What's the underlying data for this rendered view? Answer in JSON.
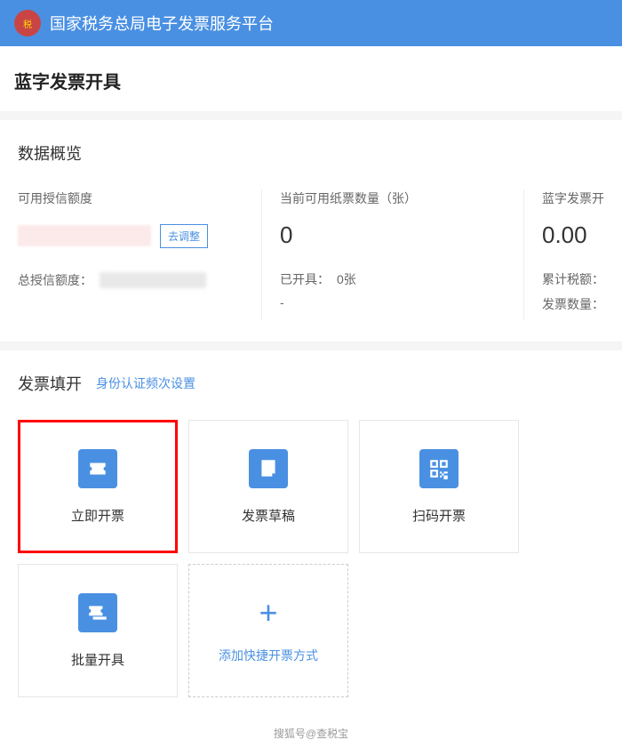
{
  "header": {
    "title": "国家税务总局电子发票服务平台"
  },
  "page": {
    "title": "蓝字发票开具"
  },
  "overview": {
    "section_title": "数据概览",
    "credit_label": "可用授信额度",
    "adjust_btn": "去调整",
    "total_credit_label": "总授信额度：",
    "paper_label": "当前可用纸票数量（张）",
    "paper_value": "0",
    "issued_label": "已开具：",
    "issued_value": "0张",
    "dash": "-",
    "blue_label_partial": "蓝字发票开",
    "blue_value": "0.00",
    "tax_total_label": "累计税额：",
    "invoice_count_label": "发票数量："
  },
  "fillin": {
    "title": "发票填开",
    "auth_link": "身份认证频次设置",
    "tiles": {
      "immediate": "立即开票",
      "draft": "发票草稿",
      "scan": "扫码开票",
      "batch": "批量开具",
      "add": "添加快捷开票方式"
    }
  },
  "footer": {
    "mark": "搜狐号@查税宝"
  }
}
